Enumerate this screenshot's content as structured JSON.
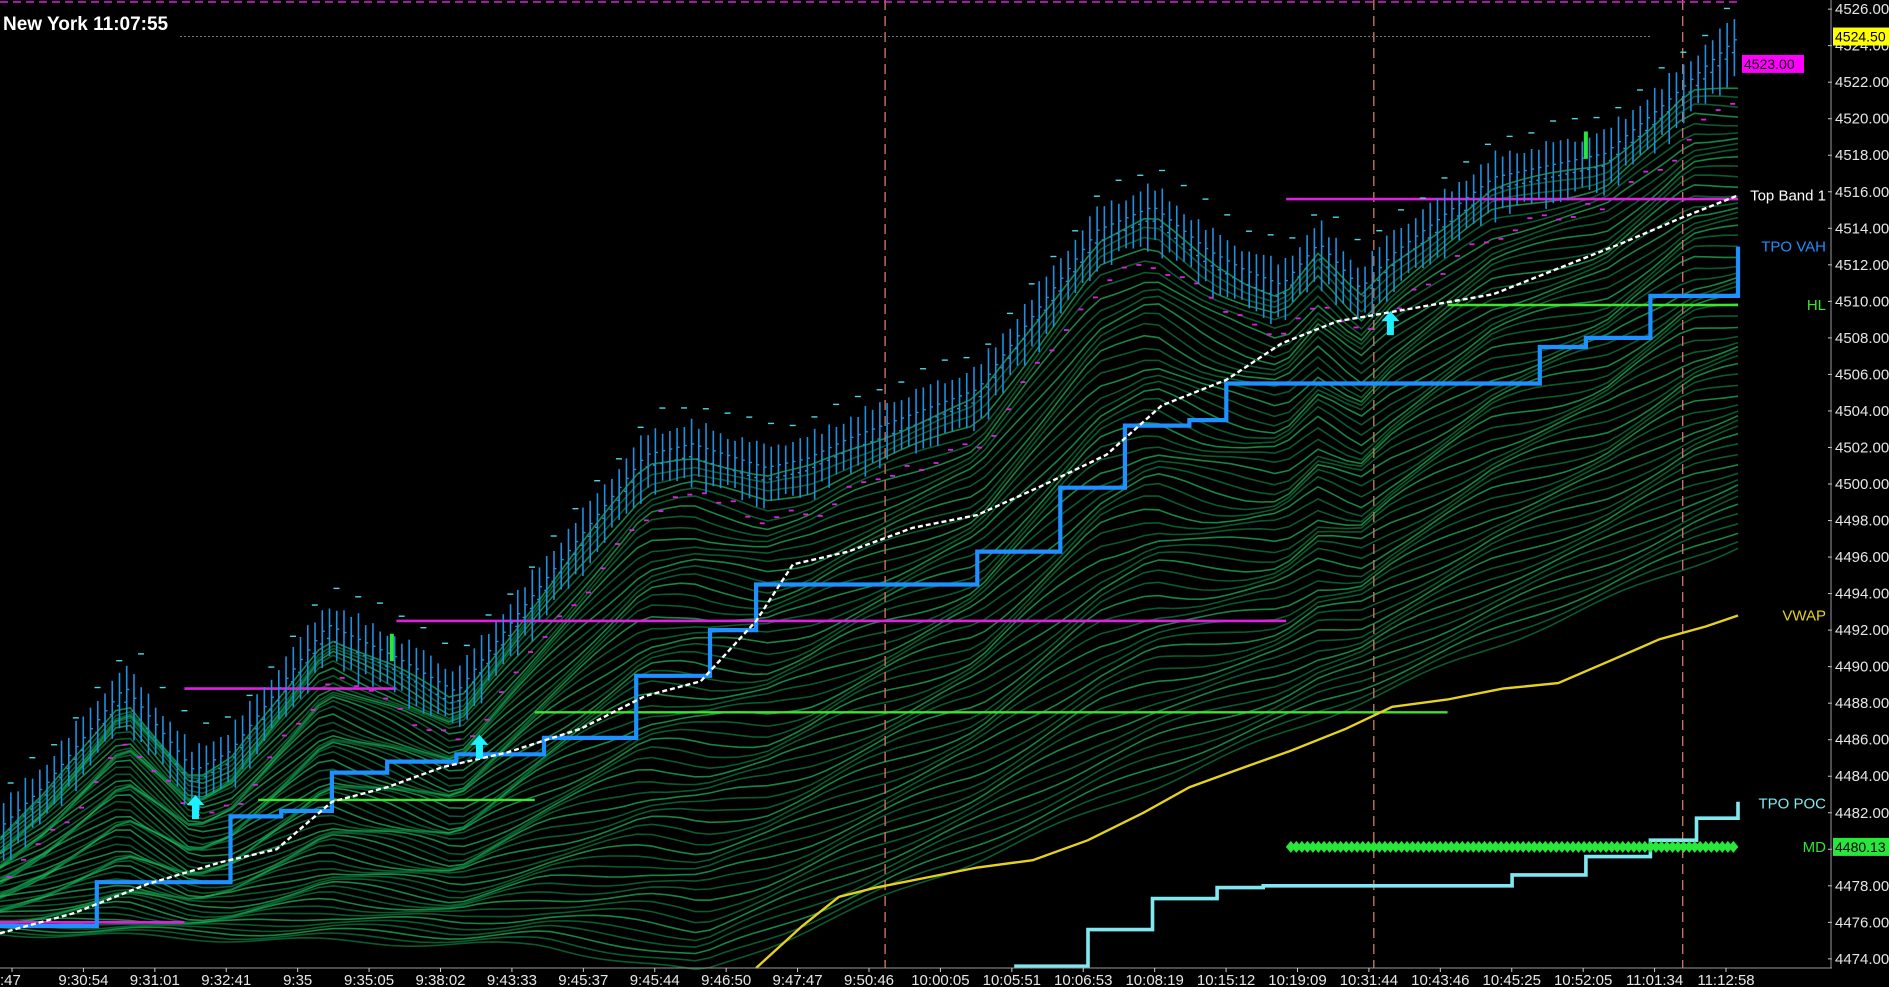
{
  "clock": {
    "label": "New York 11:07:55"
  },
  "colors": {
    "background": "#000000",
    "candle": "#1f8fe0",
    "ribbon_a": "#0c7a3c",
    "ribbon_b": "#1fb35a",
    "stair": "#1e90ff",
    "tpo_poc": "#7fe8f0",
    "vwap": "#e6d21e",
    "vwap_dash": "#ffffff",
    "magenta": "#e020e0",
    "lime": "#3ee62a",
    "md_diamond": "#29e63a",
    "arrow": "#1ef0ff",
    "session": "#c8745a",
    "axis_bg": "#000000"
  },
  "chart_data": {
    "type": "line",
    "title": "",
    "xlabel": "",
    "ylabel": "",
    "ylim": [
      4473.5,
      4526.5
    ],
    "y_ticks": [
      4474,
      4476,
      4478,
      4480,
      4482,
      4484,
      4486,
      4488,
      4490,
      4492,
      4494,
      4496,
      4498,
      4500,
      4502,
      4504,
      4506,
      4508,
      4510,
      4512,
      4514,
      4516,
      4518,
      4520,
      4522,
      4524,
      4526
    ],
    "y_tick_labels": [
      "4474.00",
      "4476.00",
      "4478.00",
      "4480.00",
      "4482.00",
      "4484.00",
      "4486.00",
      "4488.00",
      "4490.00",
      "4492.00",
      "4494.00",
      "4496.00",
      "4498.00",
      "4500.00",
      "4502.00",
      "4504.00",
      "4506.00",
      "4508.00",
      "4510.00",
      "4512.00",
      "4514.00",
      "4516.00",
      "4518.00",
      "4520.00",
      "4522.00",
      "4524.00",
      "4526.00"
    ],
    "x_ticks": [
      ":47",
      "9:30:54",
      "9:31:01",
      "9:32:41",
      "9:35",
      "9:35:05",
      "9:38:02",
      "9:43:33",
      "9:45:37",
      "9:45:44",
      "9:46:50",
      "9:47:47",
      "9:50:46",
      "10:00:05",
      "10:05:51",
      "10:06:53",
      "10:08:19",
      "10:15:12",
      "10:19:09",
      "10:31:44",
      "10:43:46",
      "10:45:25",
      "10:52:05",
      "11:01:34",
      "11:12:58"
    ],
    "price_tags": [
      {
        "label": "4524.50",
        "value": 4524.5,
        "color": "#ffff00"
      },
      {
        "label": "4523.00",
        "value": 4523.0,
        "color": "#ff00ff"
      },
      {
        "label": "4480.13",
        "value": 4480.13,
        "color": "#29e63a"
      }
    ],
    "line_labels": [
      {
        "label": "Top Band 1",
        "value": 4515.8,
        "color": "#ffffff"
      },
      {
        "label": "TPO VAH",
        "value": 4513.0,
        "color": "#1e90ff"
      },
      {
        "label": "HL",
        "value": 4509.8,
        "color": "#3ee62a"
      },
      {
        "label": "VWAP",
        "value": 4492.8,
        "color": "#e6d21e"
      },
      {
        "label": "TPO POC",
        "value": 4482.5,
        "color": "#7fe8f0"
      },
      {
        "label": "MD",
        "value": 4480.13,
        "color": "#29e63a"
      }
    ],
    "close_series": [
      [
        0,
        4481.2
      ],
      [
        0.5,
        4483.6
      ],
      [
        1.35,
        4488.9
      ],
      [
        2.1,
        4484.3
      ],
      [
        2.5,
        4485.4
      ],
      [
        3.55,
        4492.3
      ],
      [
        4.3,
        4490.5
      ],
      [
        4.95,
        4488.6
      ],
      [
        5.6,
        4492.8
      ],
      [
        7.0,
        4501.6
      ],
      [
        7.5,
        4502.2
      ],
      [
        8.3,
        4500.9
      ],
      [
        8.75,
        4501.4
      ],
      [
        9.2,
        4502.5
      ],
      [
        10.6,
        4505.2
      ],
      [
        11.9,
        4513.9
      ],
      [
        12.5,
        4515.2
      ],
      [
        13.1,
        4512.8
      ],
      [
        13.5,
        4511.7
      ],
      [
        13.9,
        4510.9
      ],
      [
        14.3,
        4513.2
      ],
      [
        14.75,
        4510.7
      ],
      [
        15.1,
        4512.6
      ],
      [
        16.2,
        4516.8
      ],
      [
        17.4,
        4518.1
      ],
      [
        18.0,
        4520.6
      ],
      [
        18.85,
        4524.5
      ]
    ],
    "vwap_white": [
      [
        0,
        4475.4
      ],
      [
        0.8,
        4476.5
      ],
      [
        1.6,
        4478.1
      ],
      [
        2.4,
        4479.3
      ],
      [
        3.0,
        4480.0
      ],
      [
        3.6,
        4482.6
      ],
      [
        4.2,
        4483.4
      ],
      [
        4.8,
        4484.5
      ],
      [
        5.5,
        4485.3
      ],
      [
        6.3,
        4486.6
      ],
      [
        7.0,
        4488.4
      ],
      [
        7.6,
        4489.2
      ],
      [
        8.2,
        4492.5
      ],
      [
        8.6,
        4495.6
      ],
      [
        9.2,
        4496.3
      ],
      [
        9.9,
        4497.6
      ],
      [
        10.6,
        4498.3
      ],
      [
        11.3,
        4499.9
      ],
      [
        12.0,
        4501.6
      ],
      [
        12.6,
        4504.3
      ],
      [
        13.3,
        4505.7
      ],
      [
        13.9,
        4507.7
      ],
      [
        14.5,
        4508.9
      ],
      [
        15.3,
        4509.6
      ],
      [
        16.2,
        4510.4
      ],
      [
        17.0,
        4512.0
      ],
      [
        17.6,
        4513.2
      ],
      [
        18.2,
        4514.5
      ],
      [
        18.85,
        4515.8
      ]
    ],
    "tpo_vah_steps": [
      [
        0,
        4475.8
      ],
      [
        1.05,
        4478.2
      ],
      [
        2.5,
        4481.8
      ],
      [
        3.05,
        4482.1
      ],
      [
        3.6,
        4484.2
      ],
      [
        4.2,
        4484.8
      ],
      [
        4.95,
        4485.2
      ],
      [
        5.9,
        4486.1
      ],
      [
        6.9,
        4489.5
      ],
      [
        7.7,
        4492.0
      ],
      [
        8.2,
        4494.5
      ],
      [
        9.9,
        4494.5
      ],
      [
        10.6,
        4496.3
      ],
      [
        11.5,
        4499.8
      ],
      [
        12.2,
        4503.2
      ],
      [
        12.9,
        4503.5
      ],
      [
        13.3,
        4505.5
      ],
      [
        15.9,
        4505.5
      ],
      [
        16.7,
        4507.5
      ],
      [
        17.2,
        4508.0
      ],
      [
        17.9,
        4510.3
      ],
      [
        18.85,
        4513.0
      ]
    ],
    "tpo_poc_steps": [
      [
        11.0,
        4473.6
      ],
      [
        11.8,
        4475.6
      ],
      [
        12.5,
        4477.3
      ],
      [
        13.2,
        4477.9
      ],
      [
        13.7,
        4478.0
      ],
      [
        15.9,
        4478.0
      ],
      [
        16.4,
        4478.6
      ],
      [
        17.2,
        4479.6
      ],
      [
        17.9,
        4480.5
      ],
      [
        18.4,
        4481.7
      ],
      [
        18.85,
        4482.6
      ]
    ],
    "vwap_yellow": [
      [
        8.2,
        4473.5
      ],
      [
        8.7,
        4475.8
      ],
      [
        9.1,
        4477.4
      ],
      [
        9.5,
        4477.9
      ],
      [
        10.0,
        4478.4
      ],
      [
        10.6,
        4479.0
      ],
      [
        11.2,
        4479.4
      ],
      [
        11.8,
        4480.5
      ],
      [
        12.4,
        4482.0
      ],
      [
        12.9,
        4483.4
      ],
      [
        13.5,
        4484.5
      ],
      [
        14.0,
        4485.4
      ],
      [
        14.6,
        4486.6
      ],
      [
        15.1,
        4487.8
      ],
      [
        15.7,
        4488.2
      ],
      [
        16.3,
        4488.8
      ],
      [
        16.9,
        4489.1
      ],
      [
        17.5,
        4490.4
      ],
      [
        18.0,
        4491.5
      ],
      [
        18.5,
        4492.2
      ],
      [
        18.85,
        4492.8
      ]
    ],
    "magenta_levels": [
      {
        "x": [
          0,
          2.0
        ],
        "y": 4476.0
      },
      {
        "x": [
          2.0,
          4.3
        ],
        "y": 4488.8
      },
      {
        "x": [
          4.3,
          13.95
        ],
        "y": 4492.5
      },
      {
        "x": [
          13.95,
          18.85
        ],
        "y": 4515.6
      }
    ],
    "lime_levels": [
      {
        "x": [
          2.8,
          5.8
        ],
        "y": 4482.7
      },
      {
        "x": [
          5.8,
          15.7
        ],
        "y": 4487.5
      },
      {
        "x": [
          15.7,
          18.85
        ],
        "y": 4509.8
      }
    ],
    "md_level": {
      "x": [
        14.0,
        18.85
      ],
      "y": 4480.13
    },
    "arrows": [
      {
        "x": 2.12,
        "y": 4482.2
      },
      {
        "x": 5.2,
        "y": 4485.5
      },
      {
        "x": 15.08,
        "y": 4508.7
      }
    ],
    "green_bars": [
      {
        "x": 4.25,
        "y": [
          4490.3,
          4491.8
        ]
      },
      {
        "x": 17.2,
        "y": [
          4517.8,
          4519.3
        ]
      }
    ],
    "session_lines": [
      9.6,
      14.9,
      18.25
    ],
    "ribbon_lower": [
      [
        0,
        4475.4
      ],
      [
        3.2,
        4475.0
      ],
      [
        5.9,
        4474.7
      ],
      [
        7.6,
        4473.2
      ],
      [
        18.85,
        4496.6
      ]
    ],
    "ribbon_upper_top": 4521.5,
    "grid": false,
    "legend": "none"
  }
}
